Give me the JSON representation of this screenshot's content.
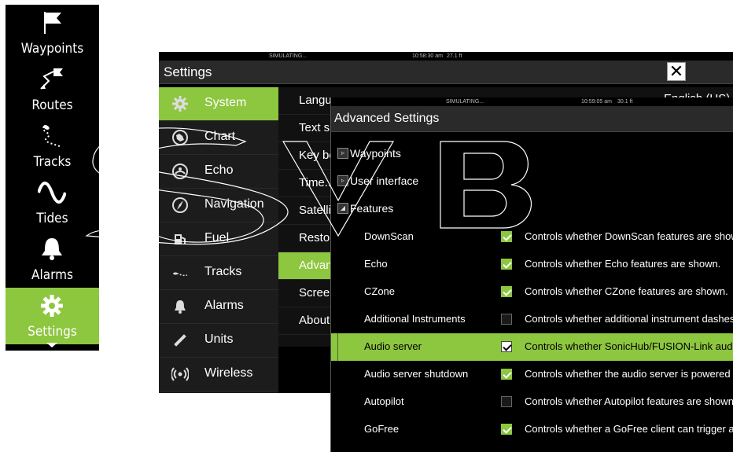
{
  "sidemenu": {
    "items": [
      {
        "label": "Waypoints",
        "icon": "flag-icon"
      },
      {
        "label": "Routes",
        "icon": "route-icon"
      },
      {
        "label": "Tracks",
        "icon": "track-icon"
      },
      {
        "label": "Tides",
        "icon": "tide-wave-icon"
      },
      {
        "label": "Alarms",
        "icon": "bell-icon"
      },
      {
        "label": "Settings",
        "icon": "gear-icon",
        "active": true
      }
    ]
  },
  "settings": {
    "status": {
      "mode": "SIMULATING...",
      "time": "10:58:30 am",
      "depth": "27.1 ft"
    },
    "title": "Settings",
    "close_label": "✕",
    "categories": [
      {
        "label": "System",
        "icon": "gear-icon",
        "active": true
      },
      {
        "label": "Chart",
        "icon": "chart-icon"
      },
      {
        "label": "Echo",
        "icon": "echo-icon"
      },
      {
        "label": "Navigation",
        "icon": "compass-icon"
      },
      {
        "label": "Fuel",
        "icon": "fuel-icon"
      },
      {
        "label": "Tracks",
        "icon": "track-icon"
      },
      {
        "label": "Alarms",
        "icon": "bell-icon"
      },
      {
        "label": "Units",
        "icon": "ruler-icon"
      },
      {
        "label": "Wireless",
        "icon": "wireless-icon"
      }
    ],
    "options": [
      {
        "label": "Language"
      },
      {
        "label": "Text si"
      },
      {
        "label": "Key be"
      },
      {
        "label": "Time..."
      },
      {
        "label": "Satelli"
      },
      {
        "label": "Restor"
      },
      {
        "label": "Advan",
        "active": true
      },
      {
        "label": "Screen"
      },
      {
        "label": "About"
      }
    ],
    "language_value": "English (US)"
  },
  "advanced": {
    "status": {
      "mode": "SIMULATING...",
      "time": "10:59:05 am",
      "depth": "30.1 ft"
    },
    "title": "Advanced Settings",
    "tree": [
      {
        "label": "Waypoints",
        "toggle": "▹"
      },
      {
        "label": "User interface",
        "toggle": "▹"
      },
      {
        "label": "Features",
        "toggle": "◢"
      }
    ],
    "features": [
      {
        "name": "DownScan",
        "checked": true,
        "desc": "Controls whether DownScan features are shown."
      },
      {
        "name": "Echo",
        "checked": true,
        "desc": "Controls whether Echo features are shown."
      },
      {
        "name": "CZone",
        "checked": true,
        "desc": "Controls whether CZone features are shown."
      },
      {
        "name": "Additional Instruments",
        "checked": false,
        "desc": "Controls whether additional instrument dashes c"
      },
      {
        "name": "Audio server",
        "checked": true,
        "desc": "Controls whether SonicHub/FUSION-Link audio f",
        "active": true
      },
      {
        "name": "Audio server shutdown",
        "checked": true,
        "desc": "Controls whether the audio server is powered off"
      },
      {
        "name": "Autopilot",
        "checked": false,
        "desc": "Controls whether Autopilot features are shown. D"
      },
      {
        "name": "GoFree",
        "checked": true,
        "desc": "Controls whether a GoFree client can trigger an e"
      }
    ]
  },
  "colors": {
    "accent": "#8dc63f",
    "panel": "#1c1c1c",
    "titlebar": "#2a2a2a"
  }
}
